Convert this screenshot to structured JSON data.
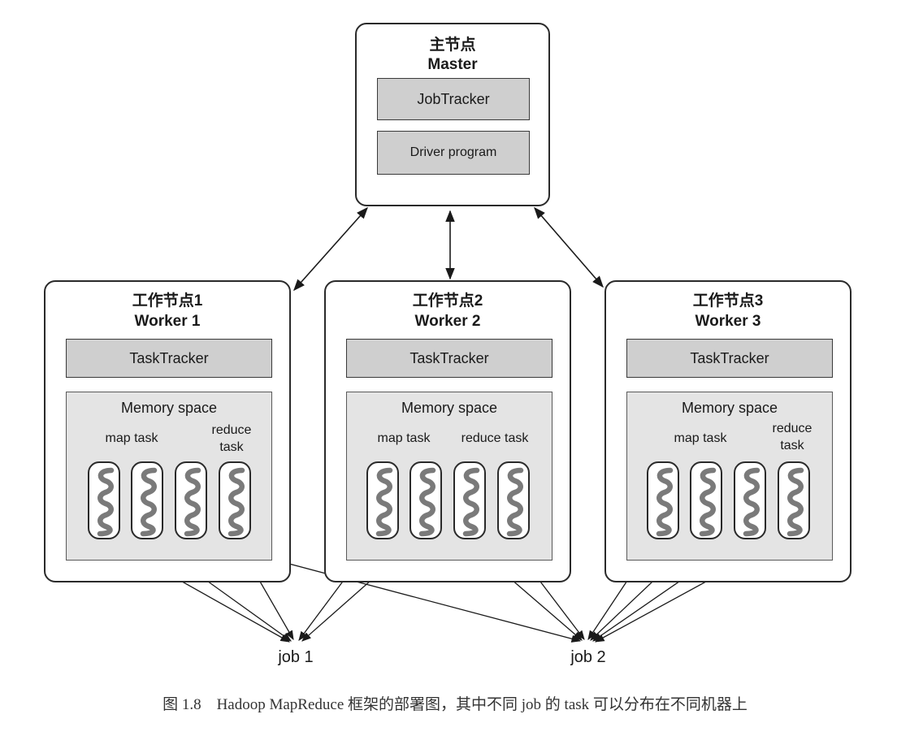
{
  "master": {
    "title_cn": "主节点",
    "title_en": "Master",
    "job_tracker": "JobTracker",
    "driver_program": "Driver program"
  },
  "workers": [
    {
      "title_cn": "工作节点1",
      "title_en": "Worker 1",
      "task_tracker": "TaskTracker",
      "memory_space": "Memory space",
      "map_task": "map task",
      "reduce_task": "reduce\ntask"
    },
    {
      "title_cn": "工作节点2",
      "title_en": "Worker 2",
      "task_tracker": "TaskTracker",
      "memory_space": "Memory space",
      "map_task": "map task",
      "reduce_task": "reduce task"
    },
    {
      "title_cn": "工作节点3",
      "title_en": "Worker 3",
      "task_tracker": "TaskTracker",
      "memory_space": "Memory space",
      "map_task": "map task",
      "reduce_task": "reduce\ntask"
    }
  ],
  "jobs": [
    "job 1",
    "job 2"
  ],
  "caption": "图 1.8　Hadoop MapReduce 框架的部署图，其中不同 job 的 task 可以分布在不同机器上",
  "colors": {
    "bar_fill": "#cfcfcf",
    "memory_fill": "#e4e4e4",
    "squiggle": "#7a7a7a",
    "line": "#1a1a1a"
  }
}
